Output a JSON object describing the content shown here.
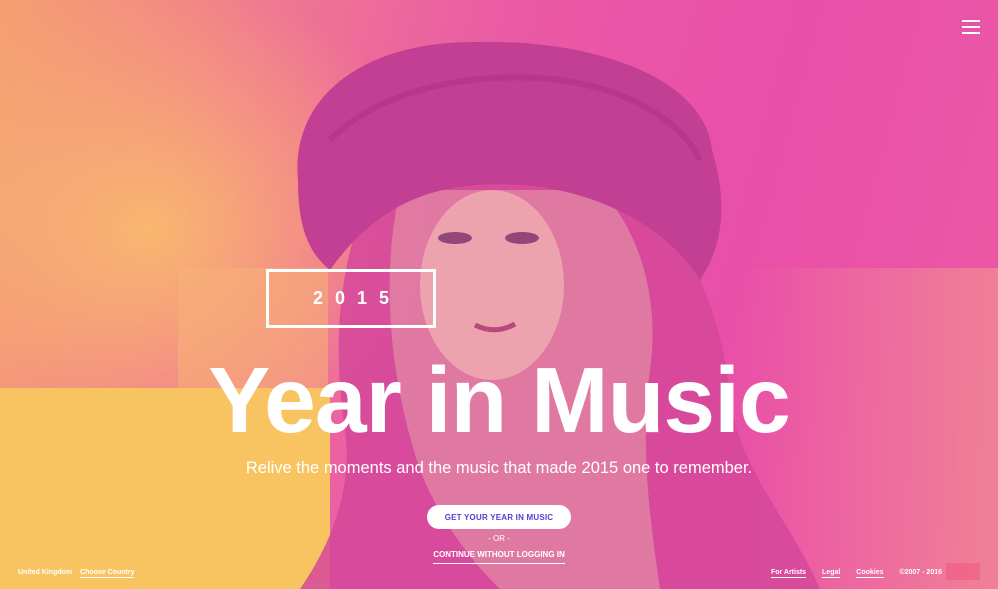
{
  "hero": {
    "year": "2015",
    "headline": "Year in Music",
    "subtitle": "Relive the moments and the music that made 2015 one to remember."
  },
  "actions": {
    "primary_label": "GET YOUR YEAR IN MUSIC",
    "or_label": "- OR -",
    "secondary_label": "CONTINUE WITHOUT LOGGING IN"
  },
  "footer": {
    "region": "United Kingdom",
    "choose_country": "Choose Country",
    "links": [
      "For Artists",
      "Legal",
      "Cookies"
    ],
    "copyright": "©2007 - 2016"
  },
  "icons": {
    "menu": "hamburger-menu-icon"
  },
  "colors": {
    "pink": "#e94fa8",
    "orange": "#f4a070",
    "yellow": "#f8c462",
    "button_text": "#5b3ad6"
  }
}
